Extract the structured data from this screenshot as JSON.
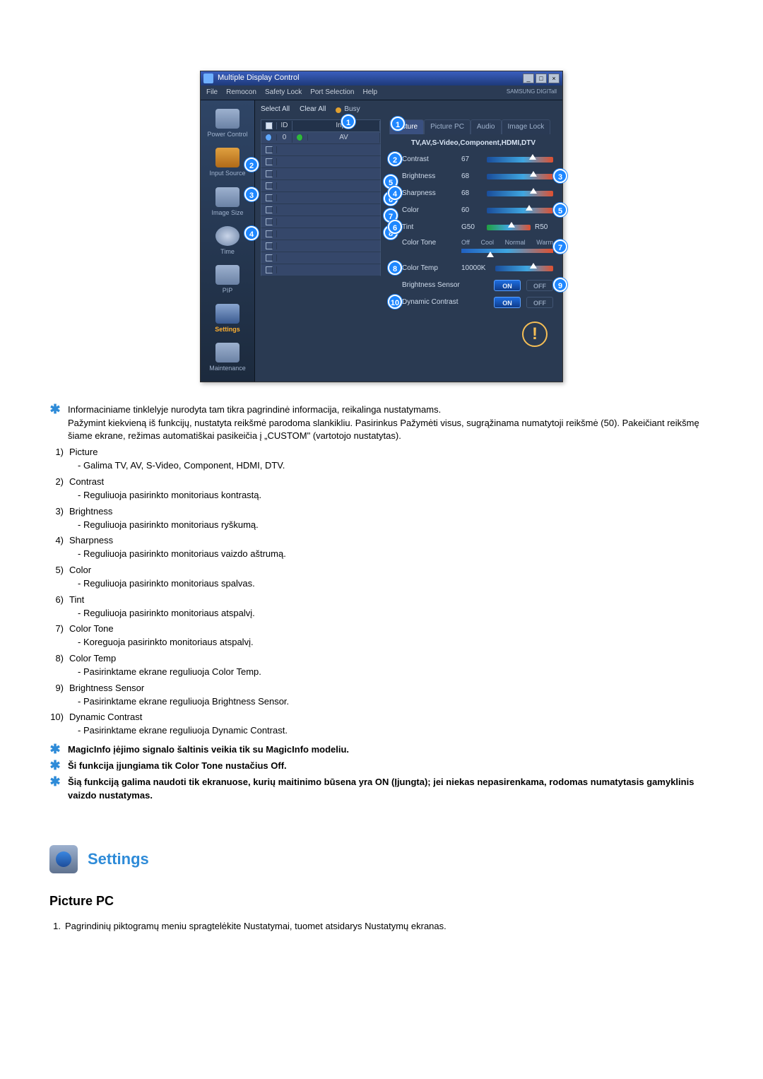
{
  "app": {
    "title": "Multiple Display Control",
    "menu": {
      "file": "File",
      "remocon": "Remocon",
      "safety": "Safety Lock",
      "port": "Port Selection",
      "help": "Help"
    },
    "logo": "SAMSUNG DIGITall"
  },
  "sidebar": {
    "power": "Power Control",
    "input": "Input Source",
    "image": "Image Size",
    "time": "Time",
    "pip": "PIP",
    "settings": "Settings",
    "maint": "Maintenance"
  },
  "top": {
    "select": "Select All",
    "clear": "Clear All",
    "busy": "Busy"
  },
  "table": {
    "h1": "✓",
    "h2": "ID",
    "h3": "",
    "h4": "Input",
    "row0_id": "0",
    "row0_input": "AV"
  },
  "tabs": {
    "picture": "Picture",
    "pc": "Picture PC",
    "audio": "Audio",
    "lock": "Image Lock"
  },
  "panel": {
    "mode": "TV,AV,S-Video,Component,HDMI,DTV",
    "contrast": "Contrast",
    "contrast_v": "67",
    "brightness": "Brightness",
    "brightness_v": "68",
    "sharpness": "Sharpness",
    "sharpness_v": "68",
    "color": "Color",
    "color_v": "60",
    "tint": "Tint",
    "tint_g": "G50",
    "tint_r": "R50",
    "colortone": "Color Tone",
    "ct_off": "Off",
    "ct_cool": "Cool",
    "ct_normal": "Normal",
    "ct_warm": "Warm",
    "colortemp": "Color Temp",
    "colortemp_v": "10000K",
    "bsensor": "Brightness Sensor",
    "dyn": "Dynamic Contrast",
    "on": "ON",
    "off": "OFF"
  },
  "callouts": {
    "c1": "1",
    "c2": "2",
    "c3": "3",
    "c4": "4",
    "c5": "5",
    "c6": "6",
    "c7": "7",
    "c8": "8",
    "c9": "9",
    "c10": "10",
    "s2": "2",
    "s3": "3",
    "s4": "4"
  },
  "notes": {
    "intro": "Informaciniame tinklelyje nurodyta tam tikra pagrindinė informacija, reikalinga nustatymams.",
    "intro2": "Pažymint kiekvieną iš funkcijų, nustatyta reikšmė parodoma slankikliu. Pasirinkus Pažymėti visus, sugrąžinama numatytoji reikšmė (50). Pakeičiant reikšmę šiame ekrane, režimas automatiškai pasikeičia į „CUSTOM\" (vartotojo nustatytas).",
    "i1_t": "Picture",
    "i1_d": "- Galima TV, AV, S-Video, Component, HDMI, DTV.",
    "i2_t": "Contrast",
    "i2_d": "- Reguliuoja pasirinkto monitoriaus kontrastą.",
    "i3_t": "Brightness",
    "i3_d": "- Reguliuoja pasirinkto monitoriaus ryškumą.",
    "i4_t": "Sharpness",
    "i4_d": "- Reguliuoja pasirinkto monitoriaus vaizdo aštrumą.",
    "i5_t": "Color",
    "i5_d": "- Reguliuoja pasirinkto monitoriaus spalvas.",
    "i6_t": "Tint",
    "i6_d": "- Reguliuoja pasirinkto monitoriaus atspalvį.",
    "i7_t": "Color Tone",
    "i7_d": "- Koreguoja pasirinkto monitoriaus atspalvį.",
    "i8_t": "Color Temp",
    "i8_d": "- Pasirinktame ekrane reguliuoja Color Temp.",
    "i9_t": "Brightness Sensor",
    "i9_d": "- Pasirinktame ekrane reguliuoja Brightness Sensor.",
    "i10_t": "Dynamic Contrast",
    "i10_d": "- Pasirinktame ekrane reguliuoja Dynamic Contrast.",
    "star1": "MagicInfo įėjimo signalo šaltinis veikia tik su MagicInfo modeliu.",
    "star2": "Ši funkcija įjungiama tik Color Tone nustačius Off.",
    "star3": "Šią funkciją galima naudoti tik ekranuose, kurių maitinimo būsena yra ON (Įjungta); jei niekas nepasirenkama, rodomas numatytasis gamyklinis vaizdo nustatymas."
  },
  "section": {
    "title": "Settings",
    "h3": "Picture PC",
    "line1": "Pagrindinių piktogramų meniu spragtelėkite Nustatymai, tuomet atsidarys Nustatymų ekranas."
  }
}
